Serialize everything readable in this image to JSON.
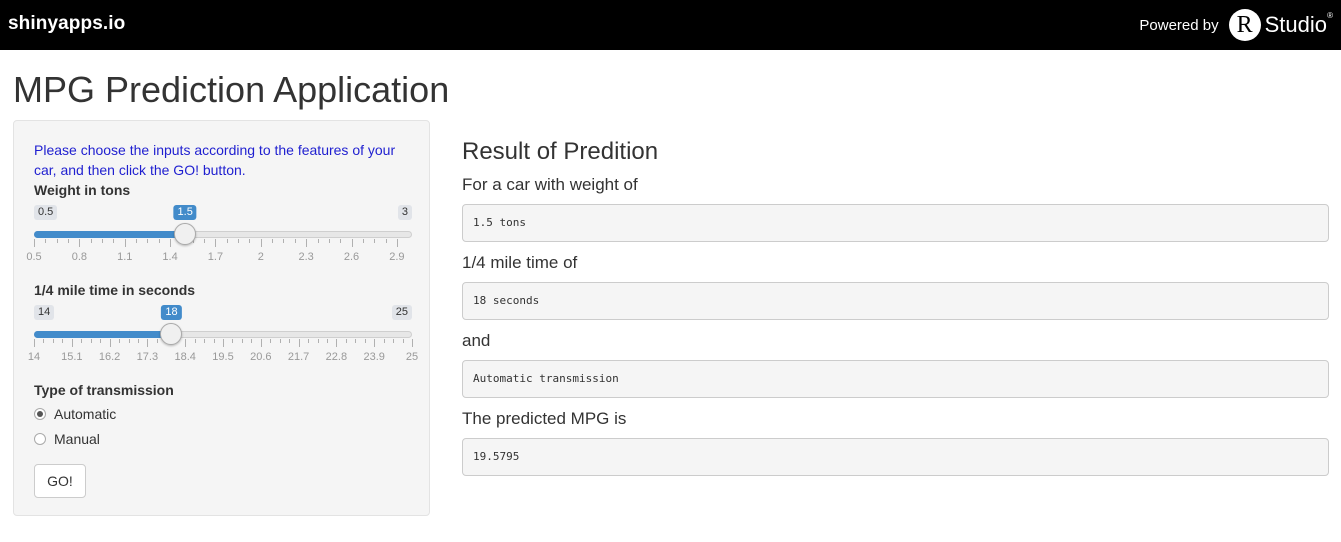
{
  "topbar": {
    "brand": "shinyapps.io",
    "powered_by": "Powered by",
    "rstudio_r": "R",
    "rstudio_text": "Studio",
    "rstudio_reg": "®"
  },
  "page_title": "MPG Prediction Application",
  "sidebar": {
    "instructions": "Please choose the inputs according to the features of your car, and then click the GO! button.",
    "weight": {
      "label": "Weight in tons",
      "min": "0.5",
      "max": "3",
      "value": "1.5",
      "ticks": [
        "0.5",
        "0.8",
        "1.1",
        "1.4",
        "1.7",
        "2",
        "2.3",
        "2.6",
        "2.9"
      ]
    },
    "time": {
      "label": "1/4 mile time in seconds",
      "min": "14",
      "max": "25",
      "value": "18",
      "ticks": [
        "14",
        "15.1",
        "16.2",
        "17.3",
        "18.4",
        "19.5",
        "20.6",
        "21.7",
        "22.8",
        "23.9",
        "25"
      ]
    },
    "transmission": {
      "label": "Type of transmission",
      "options": [
        "Automatic",
        "Manual"
      ],
      "selected": "Automatic"
    },
    "go_label": "GO!"
  },
  "results": {
    "title": "Result of Predition",
    "weight_label": "For a car with weight of",
    "weight_value": "1.5 tons",
    "time_label": "1/4 mile time of",
    "time_value": "18 seconds",
    "and_label": "and",
    "transmission_value": "Automatic transmission",
    "mpg_label": "The predicted MPG is",
    "mpg_value": "19.5795"
  },
  "colors": {
    "accent": "#428bca",
    "instruction_text": "#1f1fd0",
    "topbar_bg": "#000000"
  }
}
